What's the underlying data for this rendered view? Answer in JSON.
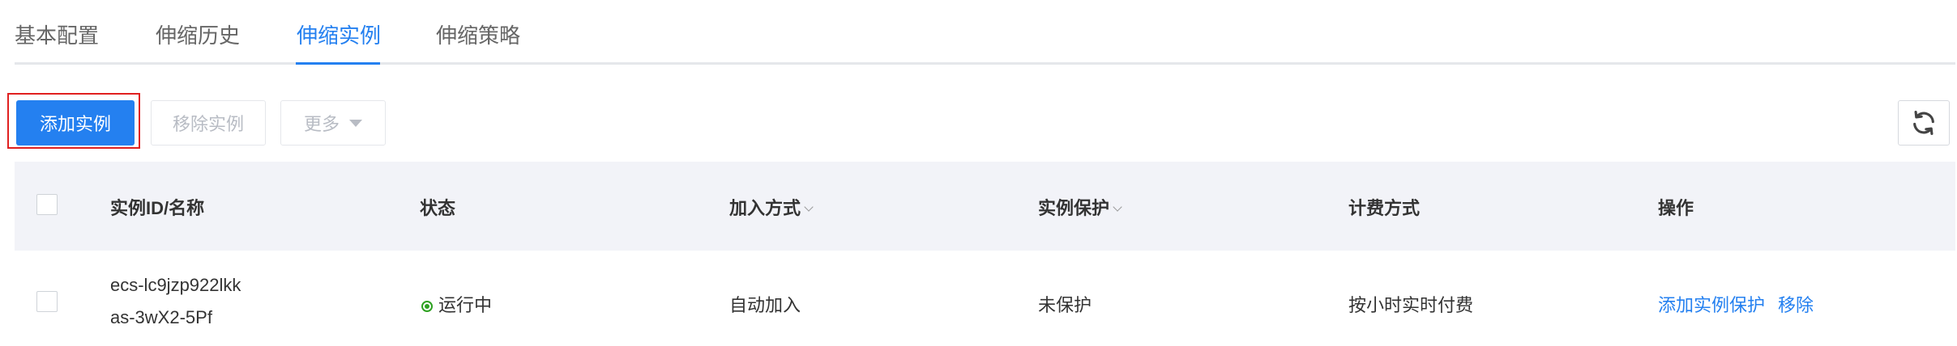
{
  "tabs": [
    {
      "label": "基本配置"
    },
    {
      "label": "伸缩历史"
    },
    {
      "label": "伸缩实例"
    },
    {
      "label": "伸缩策略"
    }
  ],
  "active_tab": "伸缩实例",
  "toolbar": {
    "add_instance": "添加实例",
    "remove_instance": "移除实例",
    "more": "更多"
  },
  "table": {
    "headers": {
      "instance": "实例ID/名称",
      "status": "状态",
      "join_method": "加入方式",
      "protection": "实例保护",
      "billing": "计费方式",
      "actions": "操作"
    },
    "rows": [
      {
        "instance_id": "ecs-lc9jzp922lkk",
        "instance_name": "as-3wX2-5Pf",
        "status": "运行中",
        "join_method": "自动加入",
        "protection": "未保护",
        "billing": "按小时实时付费",
        "action_protect": "添加实例保护",
        "action_remove": "移除"
      }
    ]
  },
  "colors": {
    "accent": "#2480f0",
    "status_running": "#2ea121",
    "highlight": "#e02020"
  }
}
